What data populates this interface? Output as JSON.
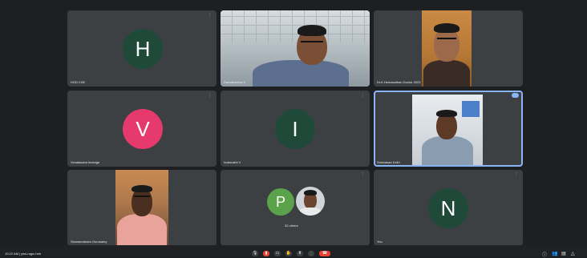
{
  "tiles": [
    {
      "name": "HOD CSE",
      "initial": "H",
      "avatar_color": "#1f4a3a"
    },
    {
      "name": "Ramakrishna V",
      "initial": "",
      "avatar_color": ""
    },
    {
      "name": "Dr.K.Hemavathan Doctor 2023",
      "initial": "",
      "avatar_color": ""
    },
    {
      "name": "Vimalasuba Imanige",
      "initial": "V",
      "avatar_color": "#e53a6b"
    },
    {
      "name": "Indarvathi V",
      "initial": "I",
      "avatar_color": "#1f4a3a"
    },
    {
      "name": "Srinivasan Dott I",
      "initial": "",
      "avatar_color": ""
    },
    {
      "name": "Sivanandaram Gurusamy",
      "initial": "",
      "avatar_color": ""
    },
    {
      "name": "32 others",
      "initial": "P",
      "avatar_color": "#5aa34b"
    },
    {
      "name": "You",
      "initial": "N",
      "avatar_color": "#1f4a3a"
    }
  ],
  "bottom_bar": {
    "time_code": "10:22 AM  |  yws-nqpc-heb",
    "controls": [
      "mic-icon",
      "camera-icon",
      "captions-icon",
      "raise-hand-icon",
      "present-icon",
      "more-icon",
      "end-call-icon"
    ]
  },
  "colors": {
    "background": "#1e1f22",
    "tile": "#3c4043",
    "active_border": "#8ab4f8",
    "end_call": "#ea4335"
  }
}
